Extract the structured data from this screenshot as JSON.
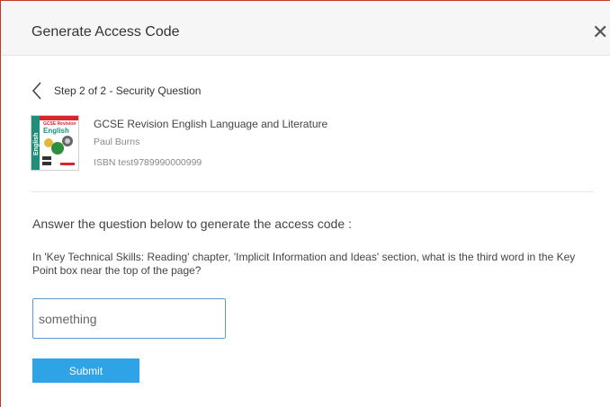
{
  "dialog": {
    "title": "Generate Access Code",
    "close_icon": "close-icon",
    "close_glyph": "✕"
  },
  "step": {
    "back_icon": "chevron-left-icon",
    "label": "Step 2 of 2 - Security Question"
  },
  "book": {
    "cover_title": "GCSE Revision",
    "cover_subject": "English",
    "title": "GCSE Revision English Language and Literature",
    "author": "Paul Burns",
    "isbn": "ISBN test9789990000999"
  },
  "prompt": "Answer the question below to generate the access code :",
  "question": "In 'Key Technical Skills: Reading' chapter, 'Implicit Information and Ideas' section, what is the third word in the Key Point box near the top of the page?",
  "answer": {
    "value": "something"
  },
  "submit_label": "Submit",
  "colors": {
    "accent": "#2ea3e5",
    "input_border": "#5b9ad5",
    "header_bg": "#f6f6f6"
  }
}
